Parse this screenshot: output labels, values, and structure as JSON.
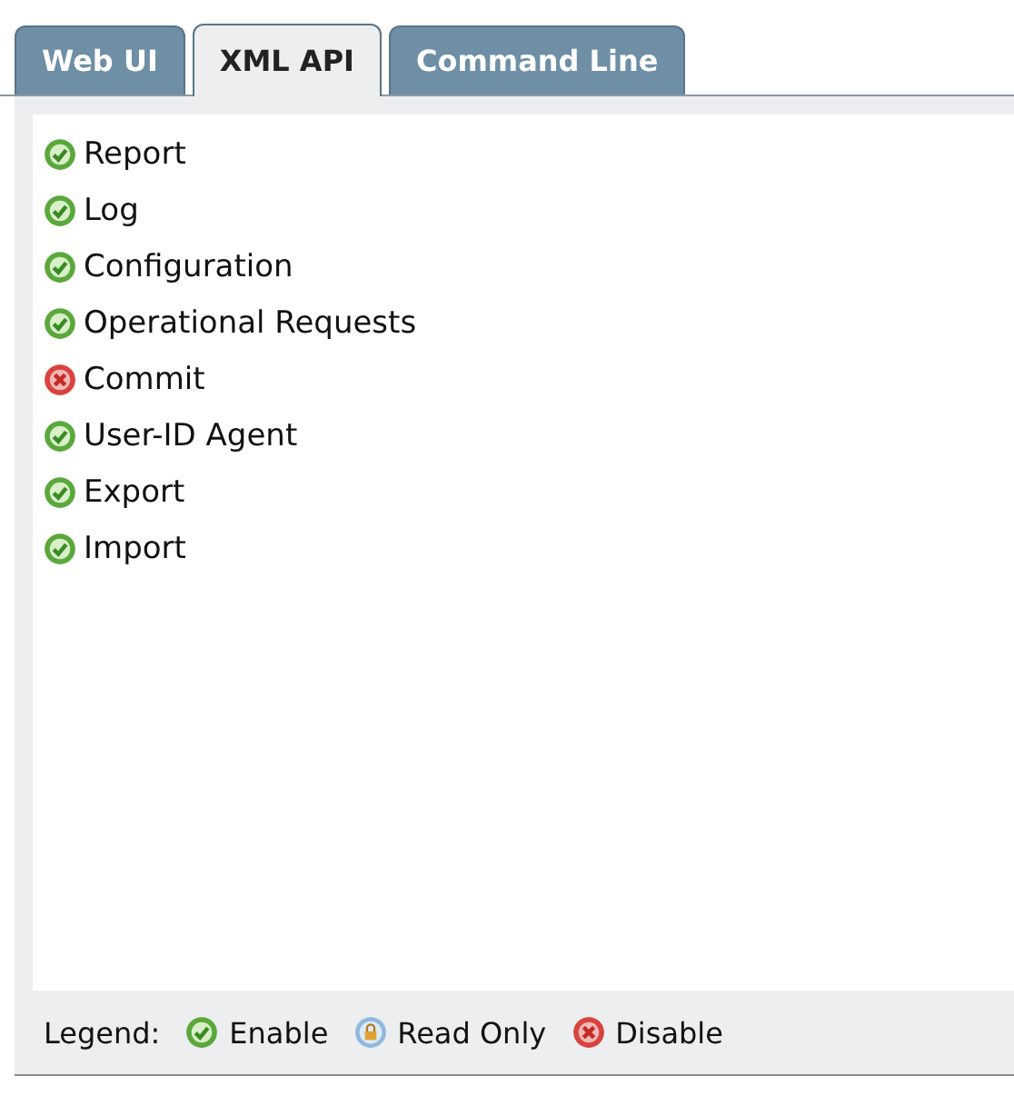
{
  "tabs": [
    {
      "label": "Web UI",
      "selected": false
    },
    {
      "label": "XML API",
      "selected": true
    },
    {
      "label": "Command Line",
      "selected": false
    }
  ],
  "items": [
    {
      "label": "Report",
      "kind": "enable"
    },
    {
      "label": "Log",
      "kind": "enable"
    },
    {
      "label": "Configuration",
      "kind": "enable"
    },
    {
      "label": "Operational Requests",
      "kind": "enable"
    },
    {
      "label": "Commit",
      "kind": "disable"
    },
    {
      "label": "User-ID Agent",
      "kind": "enable"
    },
    {
      "label": "Export",
      "kind": "enable"
    },
    {
      "label": "Import",
      "kind": "enable"
    }
  ],
  "legend": {
    "title": "Legend:",
    "entries": [
      {
        "label": "Enable",
        "kind": "enable"
      },
      {
        "label": "Read Only",
        "kind": "readonly"
      },
      {
        "label": "Disable",
        "kind": "disable"
      }
    ]
  }
}
